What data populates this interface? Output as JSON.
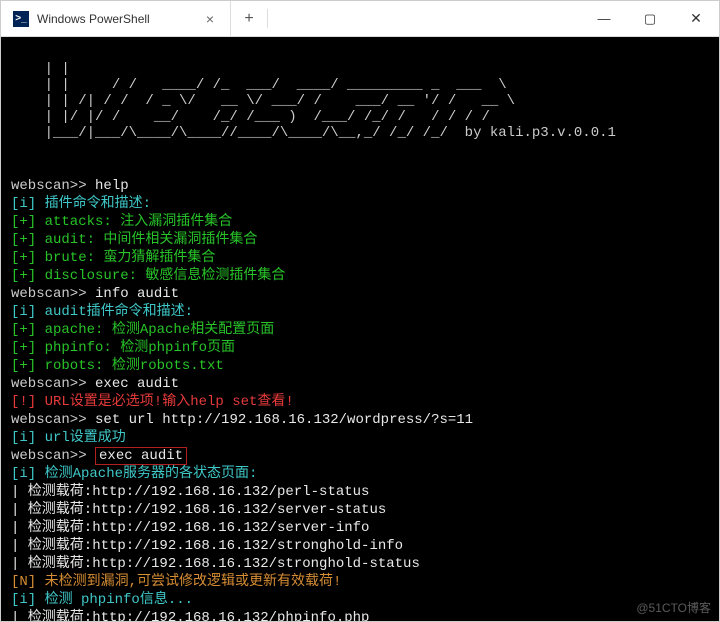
{
  "titlebar": {
    "tab_title": "Windows PowerShell",
    "tab_close": "×",
    "newtab": "+",
    "min": "—",
    "max": "▢",
    "close": "✕"
  },
  "ascii": {
    "l1": "    | |                              ",
    "l2": "    | |     / /   ____/ /_  ___/  ____/ _________ _  ___  \\",
    "l3": "    | | /| / /  / _ \\/   __ \\/ ___/ /    ___/ __ '/ /   __ \\",
    "l4": "    | |/ |/ /    __/    /_/ /___ )  /___/ /_/ /   / / / /",
    "l5": "    |___/|___/\\____/\\____//____/\\____/\\__,_/ /_/ /_/  by kali.p3.v.0.0.1"
  },
  "lines": {
    "p_help_prompt": "webscan>> ",
    "p_help_cmd": "help",
    "i_desc": "[i] 插件命令和描述:",
    "attacks": "[+] attacks: 注入漏洞插件集合",
    "audit": "[+] audit: 中间件相关漏洞插件集合",
    "brute": "[+] brute: 蛮力猜解插件集合",
    "disclosure": "[+] disclosure: 敏感信息检测插件集合",
    "p_info_prompt": "webscan>> ",
    "p_info_cmd": "info audit",
    "i_audit": "[i] audit插件命令和描述:",
    "apache": "[+] apache: 检测Apache相关配置页面",
    "phpinfo": "[+] phpinfo: 检测phpinfo页面",
    "robots": "[+] robots: 检测robots.txt",
    "p_exec1_prompt": "webscan>> ",
    "p_exec1_cmd": "exec audit",
    "url_warn": "[!] URL设置是必选项!输入help set查看!",
    "p_set_prompt": "webscan>> ",
    "p_set_cmd": "set url http://192.168.16.132/wordpress/?s=11",
    "url_ok": "[i] url设置成功",
    "p_exec2_prompt": "webscan>> ",
    "p_exec2_cmd": "exec audit",
    "apache_pages": "[i] 检测Apache服务器的各状态页面:",
    "pl1": "| 检测载荷:http://192.168.16.132/perl-status",
    "pl2": "| 检测载荷:http://192.168.16.132/server-status",
    "pl3": "| 检测载荷:http://192.168.16.132/server-info",
    "pl4": "| 检测载荷:http://192.168.16.132/stronghold-info",
    "pl5": "| 检测载荷:http://192.168.16.132/stronghold-status",
    "novuln": "[N] 未检测到漏洞,可尝试修改逻辑或更新有效载荷!",
    "phpinfo_chk": "[i] 检测 phpinfo信息...",
    "pl6": "| 检测载荷:http://192.168.16.132/phpinfo.php"
  },
  "watermark": "@51CTO博客"
}
